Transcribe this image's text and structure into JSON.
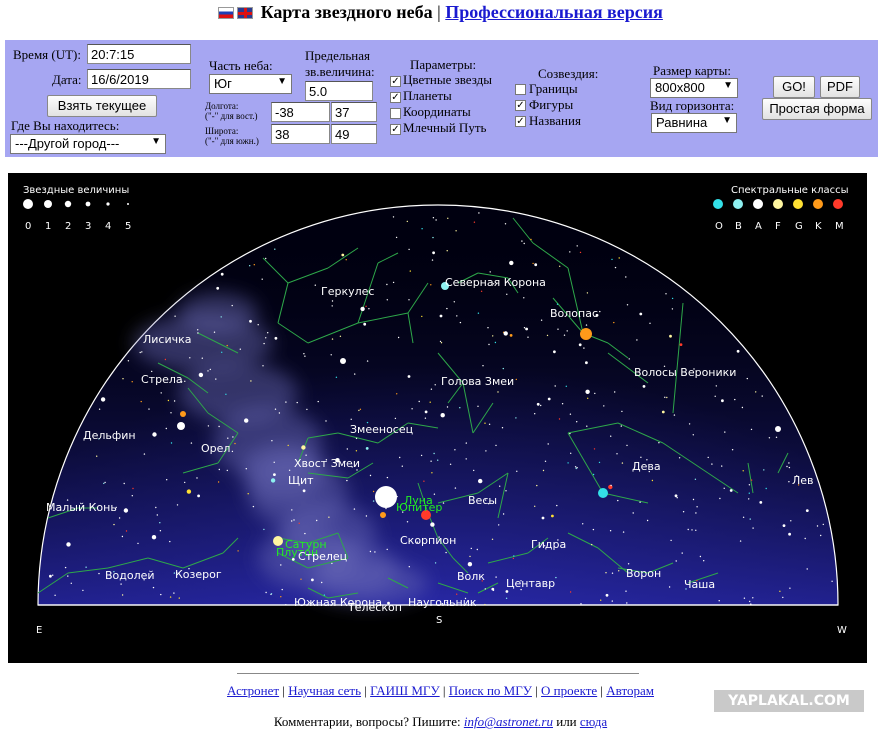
{
  "header": {
    "title": "Карта звездного неба",
    "separator": "|",
    "pro_link": "Профессиональная версия"
  },
  "form": {
    "time_label": "Время (UT):",
    "time_value": "20:7:15",
    "date_label": "Дата:",
    "date_value": "16/6/2019",
    "now_button": "Взять текущее",
    "location_label": "Где Вы находитесь:",
    "location_value": "---Другой город---",
    "sky_part_label": "Часть неба:",
    "sky_part_value": "Юг",
    "longitude_label": "Долгота:",
    "longitude_hint": "(\"-\" для вост.)",
    "latitude_label": "Широта:",
    "latitude_hint": "(\"-\" для южн.)",
    "lon_deg": "-38",
    "lon_min": "37",
    "lat_deg": "38",
    "lat_min": "49",
    "mag_label_1": "Предельная",
    "mag_label_2": "зв.величина:",
    "mag_value": "5.0",
    "params_label": "Параметры:",
    "params": [
      {
        "label": "Цветные звезды",
        "checked": true
      },
      {
        "label": "Планеты",
        "checked": true
      },
      {
        "label": "Координаты",
        "checked": false
      },
      {
        "label": "Млечный Путь",
        "checked": true
      }
    ],
    "const_label": "Созвездия:",
    "constellations": [
      {
        "label": "Границы",
        "checked": false
      },
      {
        "label": "Фигуры",
        "checked": true
      },
      {
        "label": "Названия",
        "checked": true
      }
    ],
    "size_label": "Размер карты:",
    "size_value": "800x800",
    "horizon_label": "Вид горизонта:",
    "horizon_value": "Равнина",
    "go_button": "GO!",
    "pdf_button": "PDF",
    "simple_button": "Простая форма"
  },
  "map": {
    "mag_legend_title": "Звездные величины",
    "mag_legend_values": [
      "0",
      "1",
      "2",
      "3",
      "4",
      "5"
    ],
    "spec_legend_title": "Спектральные классы",
    "spec_legend_values": [
      "O",
      "B",
      "A",
      "F",
      "G",
      "K",
      "M"
    ],
    "spec_colors": [
      "#33e0e8",
      "#8ef0f0",
      "#ffffff",
      "#fff6a0",
      "#ffe033",
      "#ff9a1a",
      "#ff3a2a"
    ],
    "compass": {
      "east": "E",
      "south": "S",
      "west": "W"
    },
    "constellation_color": "#2ea84a",
    "label_color": "#ffffff",
    "body_label_color": "#22ee22",
    "labels": [
      {
        "text": "Геркулес"
      },
      {
        "text": "Северная Корона"
      },
      {
        "text": "Волопас"
      },
      {
        "text": "Лисичка"
      },
      {
        "text": "Стрела"
      },
      {
        "text": "Голова Змеи"
      },
      {
        "text": "Волосы Вероники"
      },
      {
        "text": "Дельфин"
      },
      {
        "text": "Змееносец"
      },
      {
        "text": "Орел"
      },
      {
        "text": "Хвост Змеи"
      },
      {
        "text": "Щит"
      },
      {
        "text": "Дева"
      },
      {
        "text": "Лев"
      },
      {
        "text": "Весы"
      },
      {
        "text": "Малый Конь"
      },
      {
        "text": "Луна"
      },
      {
        "text": "Юпитер"
      },
      {
        "text": "Скорпион"
      },
      {
        "text": "Сатурн"
      },
      {
        "text": "Плутон"
      },
      {
        "text": "Стрелец"
      },
      {
        "text": "Гидра"
      },
      {
        "text": "Водолей"
      },
      {
        "text": "Козерог"
      },
      {
        "text": "Волк"
      },
      {
        "text": "Центавр"
      },
      {
        "text": "Ворон"
      },
      {
        "text": "Чаша"
      },
      {
        "text": "Южная Корона"
      },
      {
        "text": "Телескоп"
      },
      {
        "text": "Наугольник"
      }
    ]
  },
  "footer": {
    "links": [
      "Астронет",
      "Научная сеть",
      "ГАИШ МГУ",
      "Поиск по МГУ",
      "О проекте",
      "Авторам"
    ],
    "comment_prefix": "Комментарии, вопросы? Пишите:",
    "email": "info@astronet.ru",
    "or": "или",
    "here": "сюда",
    "watermark": "YAPLAKAL.COM"
  }
}
